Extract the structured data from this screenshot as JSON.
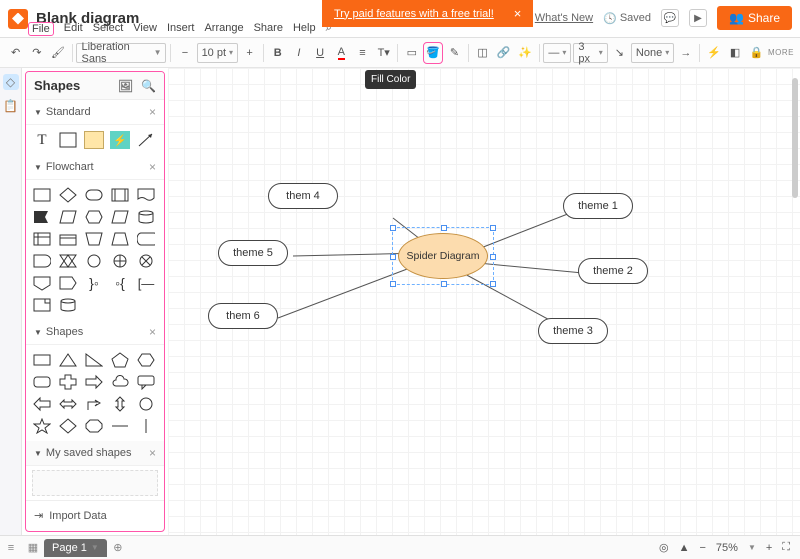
{
  "doc": {
    "title": "Blank diagram"
  },
  "promo": {
    "text": "Try paid features with a free trial!"
  },
  "menu": {
    "file": "File",
    "edit": "Edit",
    "select": "Select",
    "view": "View",
    "insert": "Insert",
    "arrange": "Arrange",
    "share": "Share",
    "help": "Help"
  },
  "header": {
    "whatsnew": "What's New",
    "saved": "Saved",
    "share": "Share"
  },
  "toolbar": {
    "font": "Liberation Sans",
    "size": "10 pt",
    "stroke": "3 px",
    "none": "None",
    "more": "MORE",
    "tooltip": "Fill Color"
  },
  "panel": {
    "title": "Shapes",
    "sections": {
      "standard": "Standard",
      "flowchart": "Flowchart",
      "shapes": "Shapes",
      "saved": "My saved shapes"
    },
    "import": "Import Data"
  },
  "nodes": {
    "center": "Spider Diagram",
    "t1": "theme 1",
    "t2": "theme 2",
    "t3": "theme 3",
    "t4": "them 4",
    "t5": "theme 5",
    "t6": "them 6"
  },
  "bottom": {
    "page": "Page 1",
    "zoom": "75%"
  }
}
